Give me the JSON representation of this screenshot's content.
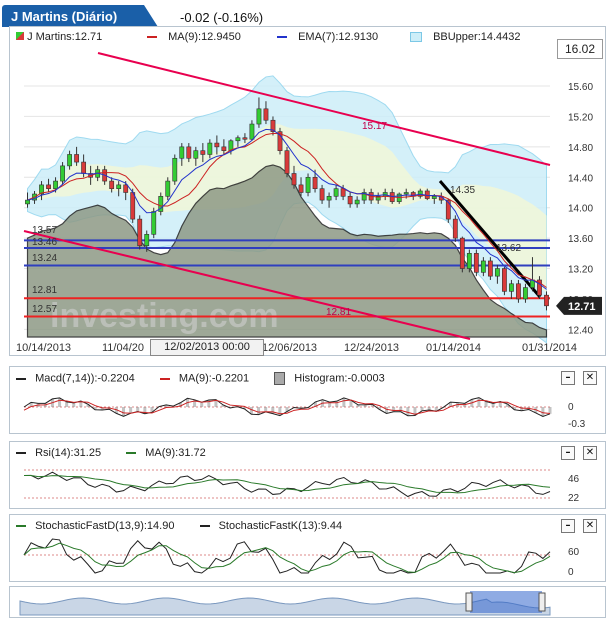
{
  "header": {
    "title": "J Martins (Diário)",
    "change": "-0.02 (-0.16%)"
  },
  "main_legend": {
    "price": "J Martins:12.71",
    "ma": "MA(9):12.9450",
    "ema": "EMA(7):12.9130",
    "bb": "BBUpper:14.4432",
    "current_label": "16.02",
    "last_price_badge": "12.71"
  },
  "colors": {
    "accent_blue": "#1a5fa8",
    "up_candle": "#33cc33",
    "down_candle": "#d93a3a",
    "ma": "#cc2222",
    "ema": "#2233cc",
    "bb_fill": "#cdeef8",
    "trend_red": "#e8004f",
    "support_blue": "#2f3fbf",
    "support_red": "#ee2222"
  },
  "watermark": "investing.com",
  "annotations": {
    "fib1": "15.17",
    "fib2": "14.35",
    "fib3": "13.62",
    "fib4": "12.81",
    "left1": "13.57",
    "left2": "13.46",
    "left3": "13.24",
    "left4": "12.81",
    "left5": "12.57"
  },
  "crosshair_label": "12/02/2013 00:00",
  "macd": {
    "label": "Macd(7,14)):-0.2204",
    "ma": "MA(9):-0.2201",
    "hist": "Histogram:-0.0003",
    "ticks": [
      "0",
      "-0.3"
    ]
  },
  "rsi": {
    "label": "Rsi(14):31.25",
    "ma": "MA(9):31.72",
    "ticks": [
      "46",
      "22"
    ]
  },
  "stoch": {
    "label_d": "StochasticFastD(13,9):14.90",
    "label_k": "StochasticFastK(13):9.44",
    "ticks": [
      "60",
      "0"
    ]
  },
  "chart_data": {
    "type": "candlestick",
    "xlabels": [
      "10/14/2013",
      "11/04/20",
      "12/06/2013",
      "12/24/2013",
      "01/14/2014",
      "01/31/2014"
    ],
    "yticks": [
      "15.60",
      "15.20",
      "14.80",
      "14.40",
      "14.00",
      "13.60",
      "13.20",
      "12.80",
      "12.40"
    ],
    "ylim": [
      12.3,
      15.85
    ],
    "ohlc": [
      [
        14.05,
        14.2,
        14.0,
        14.1
      ],
      [
        14.1,
        14.22,
        14.05,
        14.18
      ],
      [
        14.18,
        14.35,
        14.1,
        14.3
      ],
      [
        14.3,
        14.38,
        14.2,
        14.25
      ],
      [
        14.25,
        14.4,
        14.2,
        14.35
      ],
      [
        14.35,
        14.6,
        14.3,
        14.55
      ],
      [
        14.55,
        14.75,
        14.5,
        14.7
      ],
      [
        14.7,
        14.8,
        14.55,
        14.6
      ],
      [
        14.6,
        14.7,
        14.4,
        14.45
      ],
      [
        14.45,
        14.55,
        14.3,
        14.4
      ],
      [
        14.4,
        14.55,
        14.35,
        14.5
      ],
      [
        14.5,
        14.55,
        14.3,
        14.35
      ],
      [
        14.35,
        14.4,
        14.2,
        14.25
      ],
      [
        14.25,
        14.35,
        14.15,
        14.3
      ],
      [
        14.3,
        14.35,
        14.1,
        14.2
      ],
      [
        14.2,
        14.25,
        13.8,
        13.85
      ],
      [
        13.85,
        13.9,
        13.45,
        13.5
      ],
      [
        13.5,
        13.7,
        13.42,
        13.65
      ],
      [
        13.65,
        14.0,
        13.6,
        13.95
      ],
      [
        13.95,
        14.2,
        13.9,
        14.15
      ],
      [
        14.15,
        14.4,
        14.1,
        14.35
      ],
      [
        14.35,
        14.7,
        14.3,
        14.65
      ],
      [
        14.65,
        14.85,
        14.55,
        14.8
      ],
      [
        14.8,
        14.85,
        14.6,
        14.65
      ],
      [
        14.65,
        14.8,
        14.55,
        14.75
      ],
      [
        14.75,
        14.85,
        14.6,
        14.7
      ],
      [
        14.7,
        14.9,
        14.65,
        14.85
      ],
      [
        14.85,
        14.95,
        14.7,
        14.8
      ],
      [
        14.8,
        14.9,
        14.7,
        14.75
      ],
      [
        14.75,
        14.9,
        14.7,
        14.88
      ],
      [
        14.88,
        14.95,
        14.8,
        14.92
      ],
      [
        14.92,
        14.98,
        14.85,
        14.9
      ],
      [
        14.9,
        15.15,
        14.88,
        15.1
      ],
      [
        15.1,
        15.45,
        15.05,
        15.3
      ],
      [
        15.3,
        15.4,
        15.1,
        15.15
      ],
      [
        15.15,
        15.2,
        14.95,
        15.0
      ],
      [
        15.0,
        15.05,
        14.7,
        14.75
      ],
      [
        14.75,
        14.8,
        14.4,
        14.45
      ],
      [
        14.45,
        14.55,
        14.25,
        14.3
      ],
      [
        14.3,
        14.4,
        14.15,
        14.2
      ],
      [
        14.2,
        14.45,
        14.15,
        14.4
      ],
      [
        14.4,
        14.5,
        14.2,
        14.25
      ],
      [
        14.25,
        14.3,
        14.05,
        14.1
      ],
      [
        14.1,
        14.2,
        14.0,
        14.15
      ],
      [
        14.15,
        14.3,
        14.1,
        14.25
      ],
      [
        14.25,
        14.3,
        14.1,
        14.15
      ],
      [
        14.15,
        14.2,
        14.0,
        14.05
      ],
      [
        14.05,
        14.15,
        14.0,
        14.1
      ],
      [
        14.1,
        14.25,
        14.05,
        14.2
      ],
      [
        14.2,
        14.25,
        14.05,
        14.1
      ],
      [
        14.1,
        14.2,
        14.05,
        14.15
      ],
      [
        14.15,
        14.25,
        14.1,
        14.2
      ],
      [
        14.2,
        14.25,
        14.05,
        14.08
      ],
      [
        14.08,
        14.2,
        14.05,
        14.18
      ],
      [
        14.18,
        14.25,
        14.12,
        14.2
      ],
      [
        14.2,
        14.22,
        14.1,
        14.15
      ],
      [
        14.15,
        14.25,
        14.12,
        14.22
      ],
      [
        14.22,
        14.25,
        14.1,
        14.12
      ],
      [
        14.12,
        14.18,
        14.05,
        14.15
      ],
      [
        14.15,
        14.2,
        14.05,
        14.1
      ],
      [
        14.1,
        14.12,
        13.8,
        13.85
      ],
      [
        13.85,
        13.9,
        13.55,
        13.6
      ],
      [
        13.6,
        13.62,
        13.15,
        13.2
      ],
      [
        13.2,
        13.45,
        13.15,
        13.4
      ],
      [
        13.4,
        13.45,
        13.1,
        13.15
      ],
      [
        13.15,
        13.35,
        13.1,
        13.3
      ],
      [
        13.3,
        13.35,
        13.05,
        13.1
      ],
      [
        13.1,
        13.25,
        13.0,
        13.2
      ],
      [
        13.2,
        13.22,
        12.85,
        12.9
      ],
      [
        12.9,
        13.05,
        12.8,
        13.0
      ],
      [
        13.0,
        13.05,
        12.75,
        12.8
      ],
      [
        12.8,
        13.0,
        12.75,
        12.95
      ],
      [
        12.95,
        13.35,
        12.9,
        13.05
      ],
      [
        13.05,
        13.1,
        12.8,
        12.85
      ],
      [
        12.85,
        12.9,
        12.65,
        12.71
      ]
    ]
  }
}
